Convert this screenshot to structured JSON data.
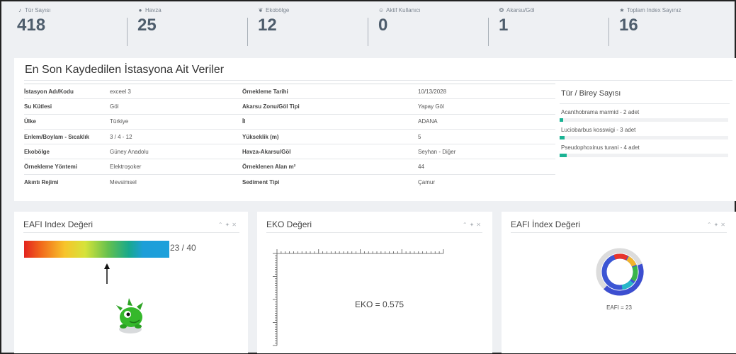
{
  "stats": [
    {
      "icon": "bell-icon",
      "glyph": "♪",
      "label": "Tür Sayısı",
      "value": "418"
    },
    {
      "icon": "globe-icon",
      "glyph": "●",
      "label": "Havza",
      "value": "25"
    },
    {
      "icon": "leaf-icon",
      "glyph": "❦",
      "label": "Ekobölge",
      "value": "12"
    },
    {
      "icon": "user-icon",
      "glyph": "☺",
      "label": "Aktif Kullanıcı",
      "value": "0"
    },
    {
      "icon": "lifebuoy-icon",
      "glyph": "❂",
      "label": "Akarsu/Göl",
      "value": "1"
    },
    {
      "icon": "star-icon",
      "glyph": "★",
      "label": "Toplam Index Sayınız",
      "value": "16"
    }
  ],
  "station": {
    "title": "En Son Kaydedilen İstasyona Ait Veriler",
    "rows": [
      [
        "İstasyon Adı/Kodu",
        "exceel 3",
        "Örnekleme Tarihi",
        "10/13/2028"
      ],
      [
        "Su Kütlesi",
        "Göl",
        "Akarsu Zonu/Göl Tipi",
        "Yapay Göl"
      ],
      [
        "Ülke",
        "Türkiye",
        "İl",
        "ADANA"
      ],
      [
        "Enlem/Boylam - Sıcaklık",
        "3 / 4 - 12",
        "Yükseklik (m)",
        "5"
      ],
      [
        "Ekobölge",
        "Güney Anadolu",
        "Havza-Akarsu/Göl",
        "Seyhan - Diğer"
      ],
      [
        "Örnekleme Yöntemi",
        "Elektroşoker",
        "Örneklenen Alan m²",
        "44"
      ],
      [
        "Akıntı Rejimi",
        "Mevsimsel",
        "Sediment Tipi",
        "Çamur"
      ]
    ]
  },
  "species": {
    "title": "Tür / Birey Sayısı",
    "accent": "#1bb394",
    "items": [
      {
        "label": "Acanthobrama marmid - 2 adet",
        "count": 2
      },
      {
        "label": "Luciobarbus kosswigi - 3 adet",
        "count": 3
      },
      {
        "label": "Pseudophoxinus turani - 4 adet",
        "count": 4
      }
    ]
  },
  "widgets": {
    "eafi1": {
      "title": "EAFI Index Değeri",
      "score": "23 / 40",
      "value": 23,
      "max": 40
    },
    "eko": {
      "title": "EKO Değeri",
      "text": "EKO = 0.575",
      "value": 0.575
    },
    "eafi2": {
      "title": "EAFI İndex Değeri",
      "text": "EAFI = 23",
      "value": 23
    }
  },
  "tool_icons": [
    "chevron-up-icon",
    "wrench-icon",
    "close-icon"
  ]
}
